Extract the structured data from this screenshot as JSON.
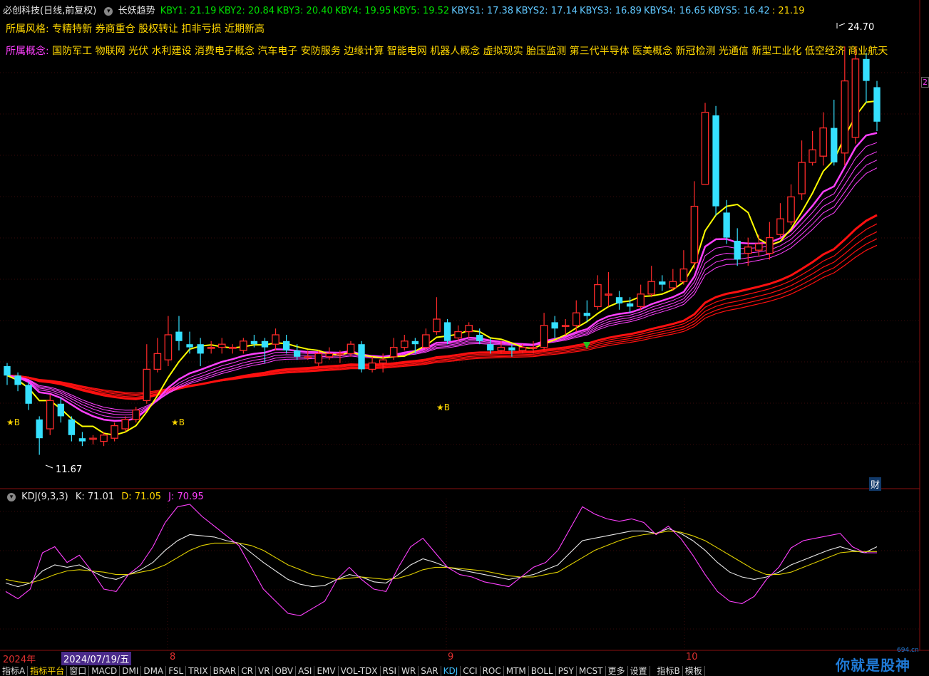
{
  "header": {
    "stock_name": "必创科技(日线,前复权)",
    "indicator_name": "长妖趋势",
    "kby": [
      {
        "label": "KBY1: 21.19",
        "cls": "kv-g"
      },
      {
        "label": "KBY2: 20.84",
        "cls": "kv-g"
      },
      {
        "label": "KBY3: 20.40",
        "cls": "kv-g"
      },
      {
        "label": "KBY4: 19.95",
        "cls": "kv-g"
      },
      {
        "label": "KBY5: 19.52",
        "cls": "kv-g"
      },
      {
        "label": "KBYS1: 17.38",
        "cls": "kv-c"
      },
      {
        "label": "KBYS2: 17.14",
        "cls": "kv-c"
      },
      {
        "label": "KBYS3: 16.89",
        "cls": "kv-c"
      },
      {
        "label": "KBYS4: 16.65",
        "cls": "kv-c"
      },
      {
        "label": "KBYS5: 16.42",
        "cls": "kv-c"
      },
      {
        "label": ": 21.19",
        "cls": "kv-y"
      }
    ],
    "colors": {
      "bg": "#000000",
      "up": "#ff2a2a",
      "down": "#35e0ff",
      "ma_yellow": "#ffff00",
      "ma_magenta": "#ff40ff",
      "ma_red": "#ff1010"
    }
  },
  "style_row": {
    "label": "所属风格:",
    "value": "专精特新 券商重仓 股权转让 扣非亏损 近期新高"
  },
  "concept_row": {
    "label": "所属概念:",
    "value": "国防军工 物联网 光伏 水利建设 消费电子概念 汽车电子 安防服务 边缘计算 智能电网 机器人概念 虚拟现实 胎压监测 第三代半导体 医美概念 新冠检测 光通信 新型工业化 低空经济 商业航天"
  },
  "annotations": {
    "high_label": "24.70",
    "low_label": "11.67",
    "cai": "财",
    "right_badge": "2",
    "star_b": "★B"
  },
  "kdj": {
    "title": "KDJ(9,3,3)",
    "k": "K: 71.01",
    "d": "D: 71.05",
    "j": "J: 70.95"
  },
  "date_axis": {
    "year": "2024年",
    "cursor_date": "2024/07/19/五",
    "m8": "8",
    "m9": "9",
    "m10": "10"
  },
  "tabs": [
    "指标A",
    "指标平台",
    "窗口",
    "MACD",
    "DMI",
    "DMA",
    "FSL",
    "TRIX",
    "BRAR",
    "CR",
    "VR",
    "OBV",
    "ASI",
    "EMV",
    "VOL-TDX",
    "RSI",
    "WR",
    "SAR",
    "KDJ",
    "CCI",
    "ROC",
    "MTM",
    "BOLL",
    "PSY",
    "MCST",
    "更多",
    "设置",
    "",
    "指标B",
    "模板"
  ],
  "watermark": {
    "text": "你就是股神",
    "site": "694.cn"
  },
  "chart_data": [
    {
      "type": "candlestick",
      "title": "必创科技(日线,前复权)",
      "ylim": [
        11.0,
        25.5
      ],
      "candles": [
        [
          14.5,
          14.2,
          14.6,
          13.9
        ],
        [
          14.2,
          13.9,
          14.3,
          13.7
        ],
        [
          13.9,
          13.3,
          14.0,
          13.1
        ],
        [
          12.8,
          12.2,
          12.9,
          11.67
        ],
        [
          12.5,
          13.4,
          13.6,
          12.3
        ],
        [
          13.3,
          12.9,
          13.5,
          12.7
        ],
        [
          12.8,
          12.3,
          12.9,
          12.1
        ],
        [
          12.2,
          12.1,
          12.4,
          11.95
        ],
        [
          12.2,
          12.2,
          12.3,
          12.0
        ],
        [
          12.1,
          12.3,
          12.4,
          11.95
        ],
        [
          12.2,
          12.6,
          12.7,
          12.1
        ],
        [
          12.5,
          12.8,
          12.9,
          12.4
        ],
        [
          12.8,
          13.1,
          13.2,
          12.7
        ],
        [
          13.4,
          14.4,
          15.2,
          13.3
        ],
        [
          14.4,
          14.9,
          15.4,
          14.3
        ],
        [
          14.7,
          15.5,
          16.1,
          14.5
        ],
        [
          15.6,
          15.3,
          16.1,
          15.0
        ],
        [
          15.2,
          15.1,
          15.6,
          14.9
        ],
        [
          15.2,
          14.9,
          15.4,
          14.5
        ],
        [
          15.1,
          15.1,
          15.3,
          14.9
        ],
        [
          15.1,
          15.2,
          15.4,
          14.9
        ],
        [
          15.1,
          15.1,
          15.2,
          14.9
        ],
        [
          15.0,
          15.3,
          15.4,
          14.9
        ],
        [
          15.3,
          15.2,
          15.5,
          15.1
        ],
        [
          15.3,
          15.1,
          15.4,
          14.6
        ],
        [
          15.2,
          15.5,
          15.7,
          15.0
        ],
        [
          15.3,
          15.0,
          15.5,
          14.9
        ],
        [
          15.0,
          14.8,
          15.2,
          14.7
        ],
        [
          14.8,
          14.8,
          15.0,
          14.7
        ],
        [
          14.6,
          14.9,
          15.0,
          14.5
        ],
        [
          14.8,
          14.9,
          15.1,
          14.7
        ],
        [
          14.9,
          14.9,
          15.0,
          14.6
        ],
        [
          14.9,
          15.2,
          15.3,
          14.8
        ],
        [
          15.2,
          14.4,
          15.3,
          14.3
        ],
        [
          14.4,
          14.6,
          14.8,
          14.3
        ],
        [
          14.6,
          14.7,
          14.9,
          14.3
        ],
        [
          14.8,
          15.1,
          15.4,
          14.7
        ],
        [
          15.1,
          15.3,
          15.5,
          15.0
        ],
        [
          15.3,
          15.2,
          15.4,
          14.9
        ],
        [
          15.1,
          15.5,
          15.7,
          15.0
        ],
        [
          15.6,
          16.0,
          16.7,
          15.5
        ],
        [
          15.9,
          15.3,
          16.0,
          15.2
        ],
        [
          15.4,
          15.6,
          15.8,
          15.3
        ],
        [
          15.6,
          15.8,
          15.9,
          15.4
        ],
        [
          15.5,
          15.3,
          15.7,
          15.2
        ],
        [
          15.2,
          15.0,
          15.4,
          14.9
        ],
        [
          15.0,
          15.1,
          15.3,
          14.9
        ],
        [
          15.1,
          15.0,
          15.2,
          14.8
        ],
        [
          15.0,
          15.1,
          15.2,
          14.9
        ],
        [
          15.1,
          15.1,
          15.3,
          14.9
        ],
        [
          15.1,
          15.8,
          16.2,
          15.0
        ],
        [
          15.9,
          15.7,
          16.1,
          15.4
        ],
        [
          15.8,
          15.8,
          16.0,
          15.5
        ],
        [
          15.8,
          16.2,
          16.6,
          15.6
        ],
        [
          16.2,
          16.1,
          16.6,
          15.9
        ],
        [
          16.4,
          17.1,
          17.4,
          16.3
        ],
        [
          16.8,
          16.8,
          17.5,
          16.4
        ],
        [
          16.7,
          16.5,
          16.9,
          16.3
        ],
        [
          16.5,
          16.4,
          16.7,
          16.2
        ],
        [
          16.4,
          16.8,
          17.1,
          16.3
        ],
        [
          16.8,
          17.2,
          17.7,
          16.7
        ],
        [
          17.2,
          17.1,
          17.4,
          16.9
        ],
        [
          17.0,
          17.2,
          17.6,
          16.9
        ],
        [
          17.2,
          17.6,
          18.2,
          17.1
        ],
        [
          17.8,
          19.6,
          20.4,
          17.6
        ],
        [
          20.3,
          22.6,
          22.9,
          21.1
        ],
        [
          22.5,
          19.6,
          22.8,
          19.3
        ],
        [
          19.4,
          18.6,
          19.8,
          18.4
        ],
        [
          18.5,
          17.9,
          18.9,
          17.7
        ],
        [
          18.1,
          18.3,
          18.6,
          17.7
        ],
        [
          18.2,
          18.4,
          18.7,
          18.0
        ],
        [
          18.1,
          18.6,
          19.1,
          17.9
        ],
        [
          18.7,
          19.2,
          19.7,
          18.6
        ],
        [
          19.1,
          19.9,
          20.3,
          19.0
        ],
        [
          20.0,
          21.0,
          21.7,
          19.8
        ],
        [
          21.0,
          21.4,
          22.0,
          20.9
        ],
        [
          21.2,
          22.1,
          22.6,
          20.9
        ],
        [
          22.1,
          21.0,
          23.0,
          20.9
        ],
        [
          21.3,
          23.6,
          24.7,
          20.9
        ],
        [
          21.8,
          24.3,
          24.7,
          21.6
        ],
        [
          24.3,
          23.6,
          24.5,
          22.9
        ],
        [
          23.4,
          22.3,
          23.6,
          22.0
        ]
      ]
    },
    {
      "type": "line",
      "title": "KDJ(9,3,3)",
      "ylim": [
        -10,
        110
      ],
      "series": [
        {
          "name": "K",
          "values": [
            45,
            42,
            45,
            55,
            60,
            58,
            60,
            55,
            50,
            48,
            52,
            56,
            62,
            72,
            80,
            85,
            84,
            83,
            80,
            78,
            70,
            62,
            55,
            48,
            44,
            42,
            43,
            48,
            52,
            50,
            46,
            45,
            52,
            60,
            65,
            62,
            58,
            56,
            54,
            52,
            50,
            48,
            50,
            52,
            56,
            60,
            70,
            80,
            82,
            84,
            86,
            88,
            88,
            86,
            90,
            86,
            80,
            72,
            62,
            54,
            50,
            48,
            50,
            54,
            60,
            64,
            68,
            72,
            75,
            72,
            70,
            75
          ]
        },
        {
          "name": "D",
          "values": [
            48,
            46,
            45,
            48,
            52,
            55,
            56,
            55,
            54,
            52,
            52,
            54,
            56,
            60,
            66,
            72,
            76,
            78,
            78,
            78,
            76,
            72,
            66,
            60,
            56,
            52,
            50,
            48,
            49,
            50,
            49,
            48,
            49,
            52,
            56,
            58,
            58,
            57,
            56,
            55,
            53,
            51,
            50,
            50,
            52,
            54,
            60,
            66,
            72,
            76,
            80,
            83,
            85,
            86,
            88,
            87,
            84,
            80,
            74,
            68,
            62,
            56,
            52,
            52,
            54,
            58,
            62,
            66,
            70,
            71,
            71,
            71
          ]
        },
        {
          "name": "J",
          "values": [
            38,
            32,
            40,
            70,
            75,
            62,
            68,
            55,
            40,
            38,
            52,
            60,
            75,
            95,
            108,
            110,
            100,
            92,
            84,
            76,
            58,
            40,
            30,
            20,
            18,
            24,
            30,
            48,
            58,
            48,
            40,
            38,
            58,
            75,
            82,
            70,
            58,
            52,
            50,
            46,
            44,
            42,
            50,
            58,
            62,
            72,
            90,
            108,
            102,
            98,
            96,
            98,
            95,
            85,
            92,
            82,
            68,
            52,
            38,
            30,
            28,
            34,
            48,
            58,
            74,
            80,
            82,
            84,
            86,
            75,
            70,
            70
          ]
        }
      ]
    }
  ]
}
